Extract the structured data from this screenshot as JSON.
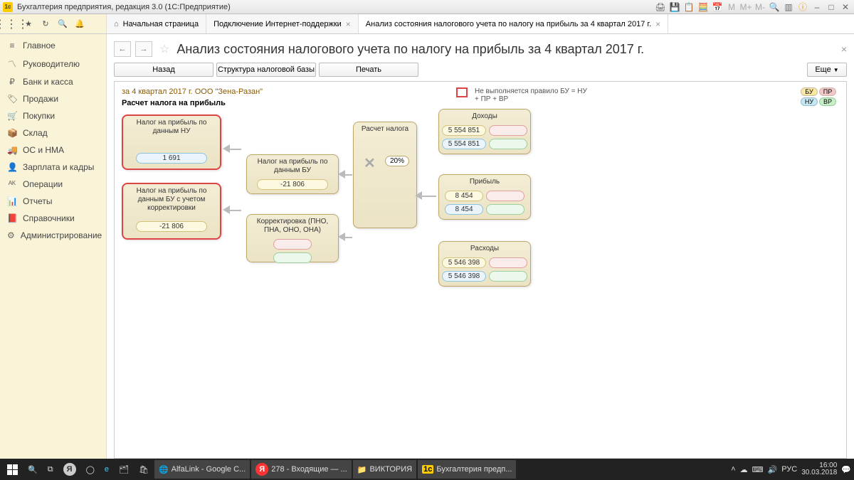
{
  "window": {
    "title": "Бухгалтерия предприятия, редакция 3.0  (1С:Предприятие)"
  },
  "tabs": {
    "home": "Начальная страница",
    "t1": "Подключение Интернет-поддержки",
    "t2": "Анализ состояния налогового учета по налогу на прибыль за 4 квартал 2017 г."
  },
  "sidebar": {
    "items": [
      "Главное",
      "Руководителю",
      "Банк и касса",
      "Продажи",
      "Покупки",
      "Склад",
      "ОС и НМА",
      "Зарплата и кадры",
      "Операции",
      "Отчеты",
      "Справочники",
      "Администрирование"
    ]
  },
  "page": {
    "title": "Анализ состояния налогового учета по налогу на прибыль за 4 квартал 2017 г.",
    "btn_back": "Назад",
    "btn_structure": "Структура налоговой базы",
    "btn_print": "Печать",
    "btn_more": "Еще"
  },
  "report": {
    "period": "за 4 квартал 2017 г. ООО \"Зена-Разан\"",
    "title": "Расчет налога на прибыль",
    "legend_text": "Не выполняется правило БУ = НУ + ПР + ВР",
    "badges": {
      "bu": "БУ",
      "pr": "ПР",
      "nu": "НУ",
      "br": "ВР"
    }
  },
  "blocks": {
    "tax_nu": {
      "title": "Налог на прибыль по данным НУ",
      "val": "1 691"
    },
    "tax_bu_corr": {
      "title": "Налог на прибыль по данным БУ с учетом корректировки",
      "val": "-21 806"
    },
    "tax_bu": {
      "title": "Налог на прибыль по данным БУ",
      "val": "-21 806"
    },
    "correction": {
      "title": "Корректировка (ПНО, ПНА, ОНО, ОНА)"
    },
    "calc": {
      "title": "Расчет налога",
      "percent": "20%"
    },
    "income": {
      "title": "Доходы",
      "bu": "5 554 851",
      "nu": "5 554 851"
    },
    "profit": {
      "title": "Прибыль",
      "bu": "8 454",
      "nu": "8 454"
    },
    "expenses": {
      "title": "Расходы",
      "bu": "5 546 398",
      "nu": "5 546 398"
    }
  },
  "taskbar": {
    "items": [
      "AlfaLink - Google C...",
      "278 - Входящие — ...",
      "ВИКТОРИЯ",
      "Бухгалтерия предп..."
    ],
    "lang": "РУС",
    "time": "16:00",
    "date": "30.03.2018"
  }
}
